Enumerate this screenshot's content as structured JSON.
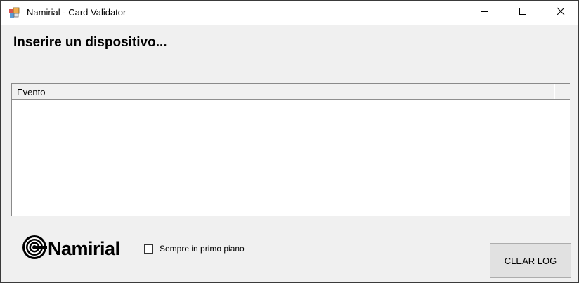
{
  "window": {
    "title": "Namirial - Card Validator",
    "icon": "app-window-icon"
  },
  "title_controls": {
    "minimize_icon": "minimize-icon",
    "maximize_icon": "maximize-icon",
    "close_icon": "close-icon"
  },
  "main": {
    "heading": "Inserire un dispositivo..."
  },
  "event_list": {
    "columns": [
      "Evento"
    ],
    "rows": []
  },
  "footer": {
    "logo_text": "Namirial",
    "logo_icon": "namirial-logo-icon",
    "always_on_top": {
      "label": "Sempre in primo piano",
      "checked": false
    },
    "clear_log_label": "CLEAR LOG"
  },
  "colors": {
    "window_bg": "#f0f0f0",
    "titlebar_bg": "#ffffff",
    "list_bg": "#ffffff",
    "button_bg": "#e1e1e1",
    "border": "#8e8e8e"
  }
}
